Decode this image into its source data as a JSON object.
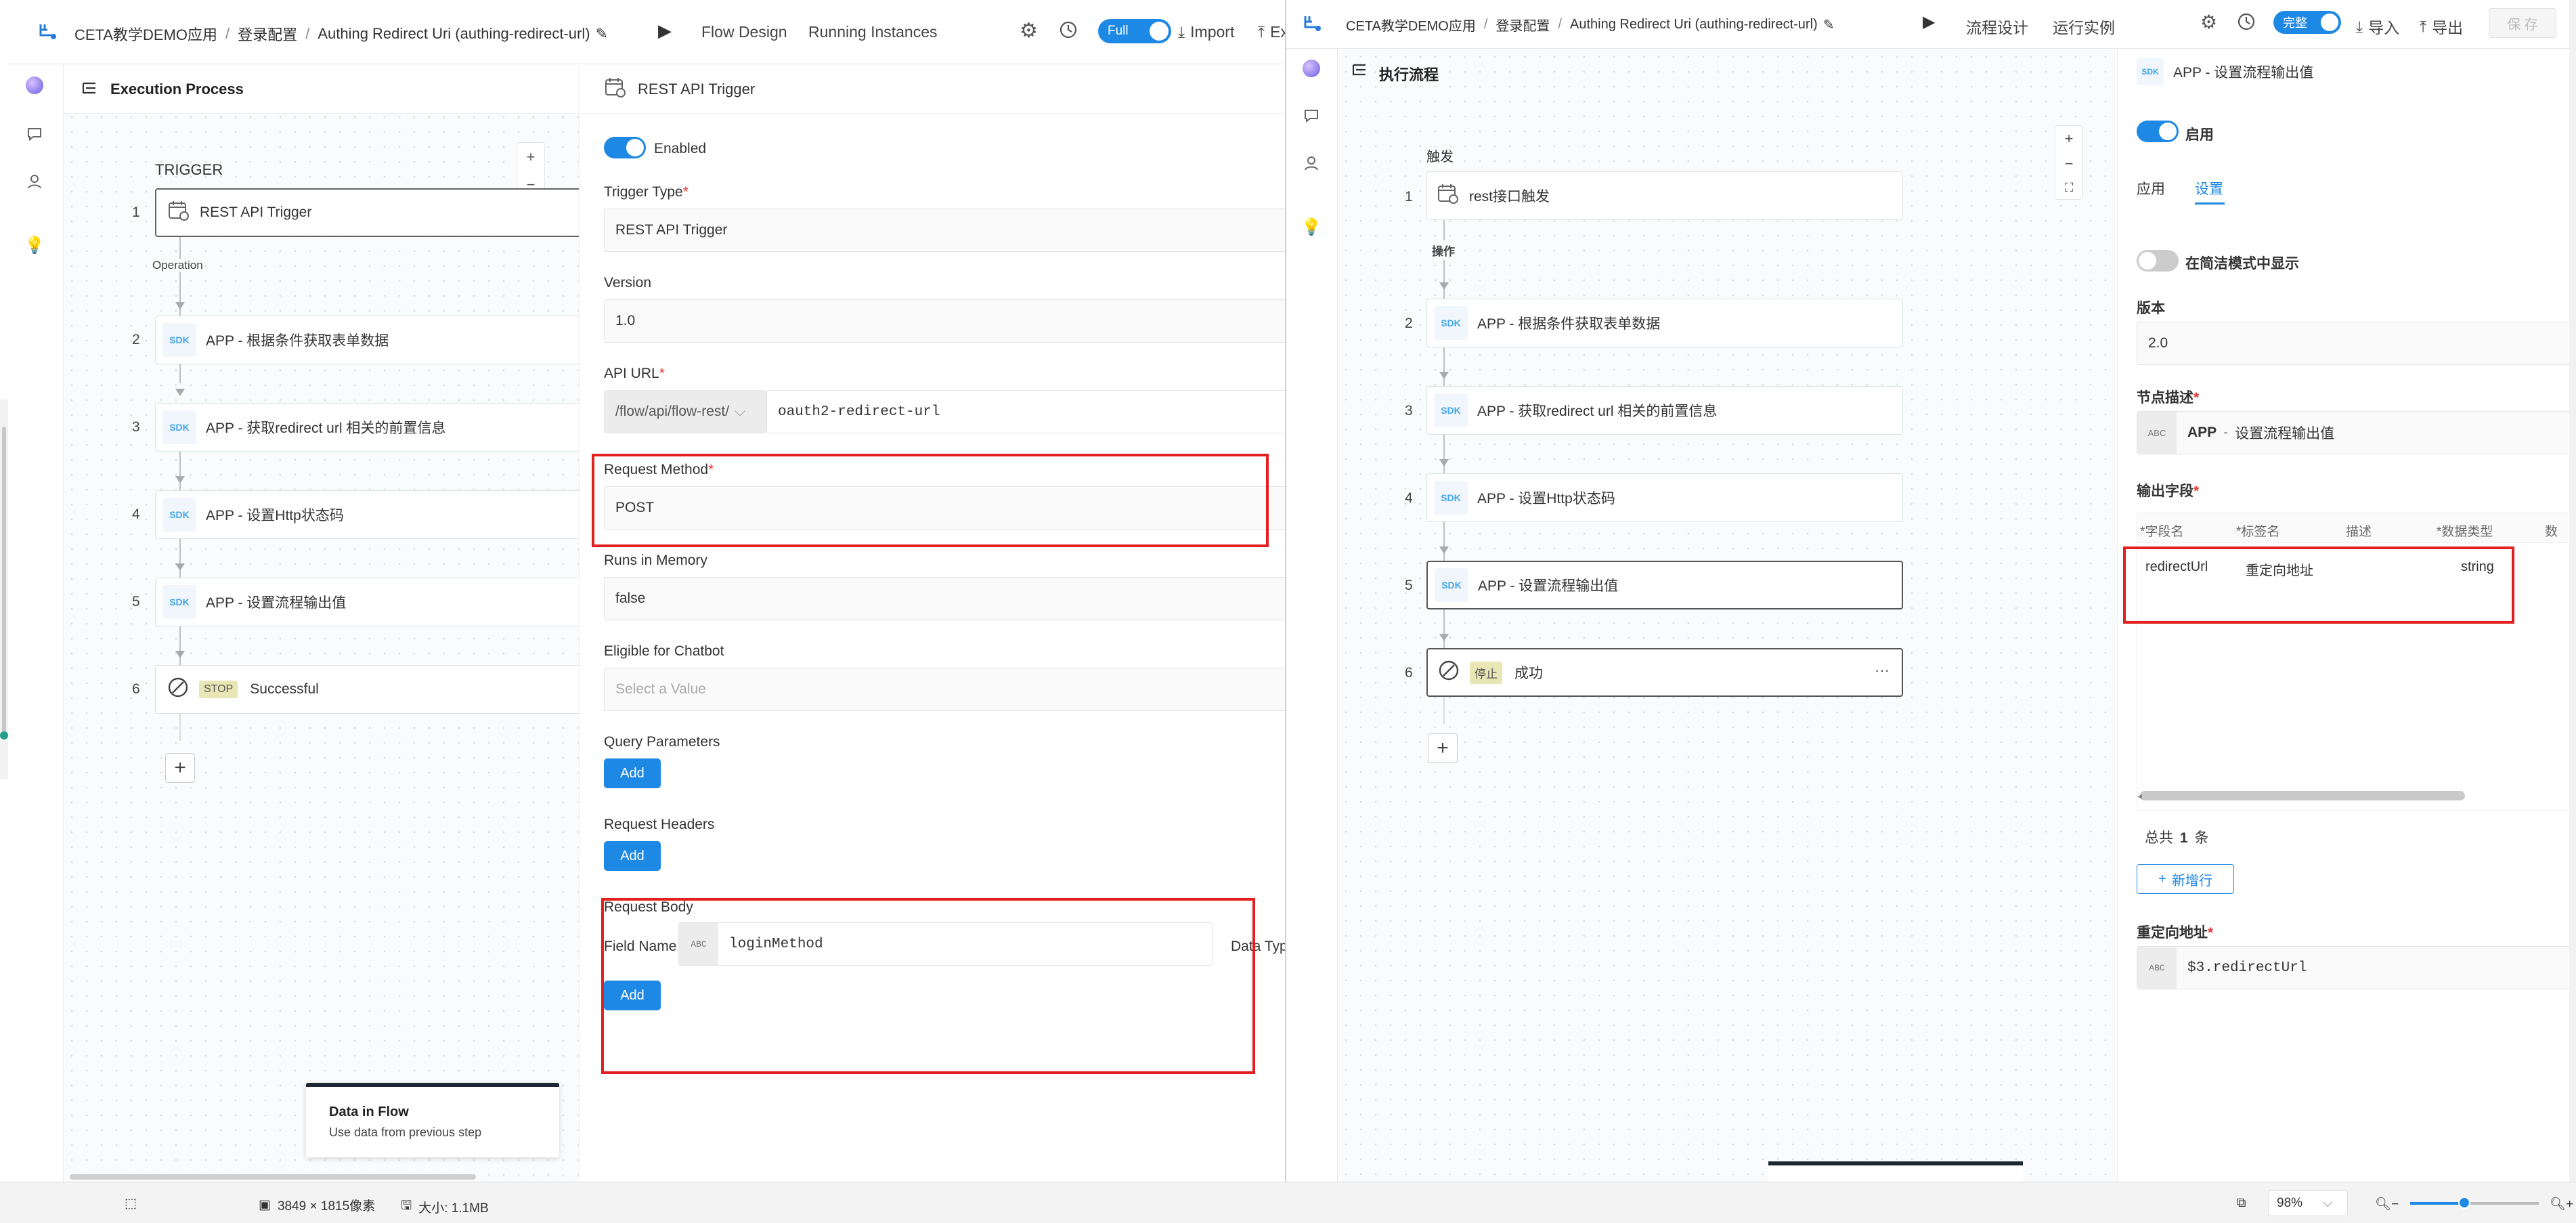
{
  "left_window": {
    "breadcrumb": [
      "CETA教学DEMO应用",
      "登录配置",
      "Authing Redirect Uri (authing-redirect-url)"
    ],
    "toolbar": {
      "flow_design": "Flow Design",
      "running_instances": "Running Instances",
      "mode": "Full",
      "import": "Import",
      "export": "Ex"
    },
    "flow": {
      "title": "Execution Process",
      "trigger_label": "TRIGGER",
      "operation_label": "Operation",
      "nodes": [
        {
          "num": "1",
          "label": "REST API Trigger",
          "icon": "calendar-trigger-icon"
        },
        {
          "num": "2",
          "label": "APP - 根据条件获取表单数据",
          "icon": "SDK"
        },
        {
          "num": "3",
          "label": "APP - 获取redirect url 相关的前置信息",
          "icon": "SDK"
        },
        {
          "num": "4",
          "label": "APP - 设置Http状态码",
          "icon": "SDK"
        },
        {
          "num": "5",
          "label": "APP - 设置流程输出值",
          "icon": "SDK"
        },
        {
          "num": "6",
          "label": "Successful",
          "badge": "STOP",
          "icon": "stop-icon"
        }
      ],
      "zoom": {
        "in": "+",
        "out": "−"
      },
      "add": "+"
    },
    "tooltip": {
      "title": "Data in Flow",
      "text": "Use data from previous step"
    },
    "form": {
      "header": "REST API Trigger",
      "enabled": "Enabled",
      "trigger_type_label": "Trigger Type",
      "trigger_type_value": "REST API Trigger",
      "version_label": "Version",
      "version_value": "1.0",
      "api_url_label": "API URL",
      "api_url_prefix": "/flow/api/flow-rest/",
      "api_url_value": "oauth2-redirect-url",
      "method_label": "Request Method",
      "method_value": "POST",
      "memory_label": "Runs in Memory",
      "memory_value": "false",
      "chatbot_label": "Eligible for Chatbot",
      "chatbot_placeholder": "Select a Value",
      "query_label": "Query Parameters",
      "headers_label": "Request Headers",
      "body_label": "Request Body",
      "field_name_label": "Field Name",
      "abc": "ABC",
      "field_name_value": "loginMethod",
      "data_type_label": "Data Type",
      "add": "Add"
    }
  },
  "right_window": {
    "breadcrumb": [
      "CETA教学DEMO应用",
      "登录配置",
      "Authing Redirect Uri (authing-redirect-url)"
    ],
    "toolbar": {
      "flow_design": "流程设计",
      "running_instances": "运行实例",
      "mode": "完整",
      "import": "导入",
      "export": "导出",
      "save": "保 存"
    },
    "flow": {
      "title": "执行流程",
      "trigger_label": "触发",
      "operation_label": "操作",
      "nodes": [
        {
          "num": "1",
          "label": "rest接口触发",
          "icon": "calendar-trigger-icon"
        },
        {
          "num": "2",
          "label": "APP - 根据条件获取表单数据",
          "icon": "SDK"
        },
        {
          "num": "3",
          "label": "APP - 获取redirect url 相关的前置信息",
          "icon": "SDK"
        },
        {
          "num": "4",
          "label": "APP - 设置Http状态码",
          "icon": "SDK"
        },
        {
          "num": "5",
          "label": "APP - 设置流程输出值",
          "icon": "SDK"
        },
        {
          "num": "6",
          "label": "成功",
          "badge": "停止",
          "icon": "stop-icon",
          "more": "···"
        }
      ],
      "zoom": {
        "in": "+",
        "out": "−"
      },
      "add": "+"
    },
    "form": {
      "header": "APP - 设置流程输出值",
      "enabled": "启用",
      "tabs": [
        "应用",
        "设置"
      ],
      "active_tab": "设置",
      "simple_mode": "在简洁模式中显示",
      "version_label": "版本",
      "version_value": "2.0",
      "desc_label": "节点描述",
      "desc_prefix": "APP",
      "desc_value": "设置流程输出值",
      "abc": "ABC",
      "output_label": "输出字段",
      "columns": [
        "*字段名",
        "*标签名",
        "描述",
        "*数据类型",
        "数"
      ],
      "rows": [
        {
          "field": "redirectUrl",
          "label": "重定向地址",
          "desc": "",
          "type": "string"
        }
      ],
      "total_prefix": "总共",
      "total_count": "1",
      "total_suffix": "条",
      "add_row": "新增行",
      "redirect_label": "重定向地址",
      "redirect_value": "$3.redirectUrl"
    }
  },
  "statusbar": {
    "dims": "3849 × 1815像素",
    "size": "大小: 1.1MB",
    "zoom": "98%",
    "zoom_level": 0.42
  },
  "colors": {
    "accent": "#1e88e5",
    "highlight": "#e32020",
    "sdk": "#43a6ea",
    "stop_badge": "#e8e6b4"
  }
}
